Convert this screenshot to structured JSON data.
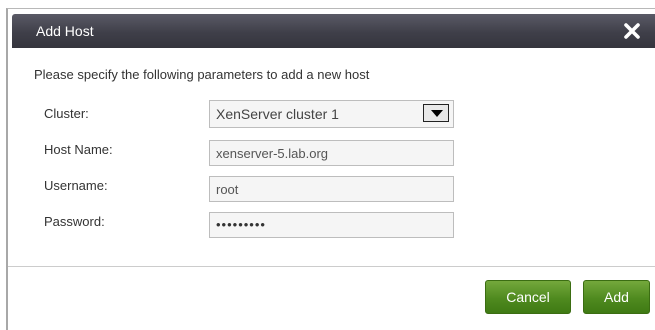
{
  "dialog": {
    "title": "Add Host",
    "close_icon": "close-icon",
    "intro": "Please specify the following parameters to add a new host"
  },
  "form": {
    "cluster": {
      "label": "Cluster:",
      "value": "XenServer cluster 1"
    },
    "host_name": {
      "label": "Host Name:",
      "value": "xenserver-5.lab.org"
    },
    "username": {
      "label": "Username:",
      "value": "root"
    },
    "password": {
      "label": "Password:",
      "value": "•••••••••"
    }
  },
  "buttons": {
    "cancel": "Cancel",
    "add": "Add"
  },
  "colors": {
    "titlebar": "#3f3f49",
    "button_green": "#4f8a1f",
    "field_border": "#bdbdbd"
  }
}
